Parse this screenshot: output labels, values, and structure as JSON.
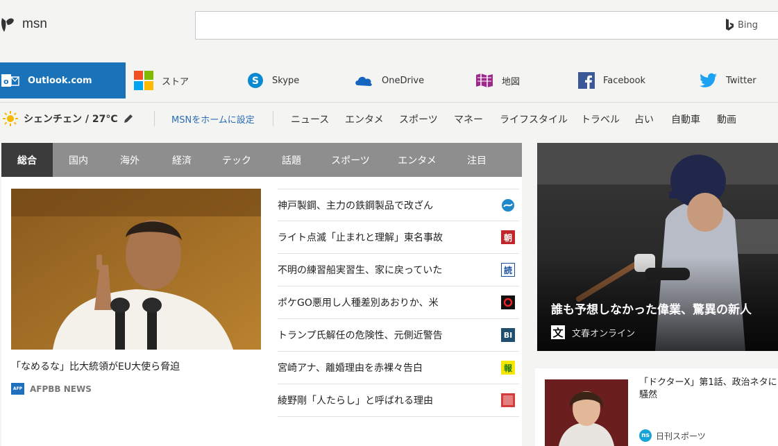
{
  "header": {
    "logo_text": "msn",
    "search_placeholder": "",
    "search_brand": "Bing"
  },
  "apps": [
    {
      "label": "Outlook.com",
      "icon": "outlook-icon"
    },
    {
      "label": "ストア",
      "icon": "store-icon"
    },
    {
      "label": "Skype",
      "icon": "skype-icon"
    },
    {
      "label": "OneDrive",
      "icon": "onedrive-icon"
    },
    {
      "label": "地図",
      "icon": "map-icon"
    },
    {
      "label": "Facebook",
      "icon": "facebook-icon"
    },
    {
      "label": "Twitter",
      "icon": "twitter-icon"
    }
  ],
  "subnav": {
    "weather": "シェンチェン / 27°C",
    "home_setting": "MSNをホームに設定",
    "links": [
      "ニュース",
      "エンタメ",
      "スポーツ",
      "マネー",
      "ライフスタイル",
      "トラベル",
      "占い",
      "自動車",
      "動画"
    ]
  },
  "tabs": [
    "総合",
    "国内",
    "海外",
    "経済",
    "テック",
    "話題",
    "スポーツ",
    "エンタメ",
    "注目"
  ],
  "hero": {
    "caption": "「なめるな」比大統領がEU大使ら脅迫",
    "source": "AFPBB NEWS",
    "source_badge": "AFP"
  },
  "headlines": [
    {
      "text": "神戸製鋼、主力の鉄鋼製品で改ざん",
      "badge": ""
    },
    {
      "text": "ライト点滅「止まれと理解」東名事故",
      "badge": "朝"
    },
    {
      "text": "不明の練習船実習生、家に戻っていた",
      "badge": "読"
    },
    {
      "text": "ポケGO悪用し人種差別あおりか、米",
      "badge": ""
    },
    {
      "text": "トランプ氏解任の危険性、元側近警告",
      "badge": "BI"
    },
    {
      "text": "宮崎アナ、離婚理由を赤裸々告白",
      "badge": "報"
    },
    {
      "text": "綾野剛「人たらし」と呼ばれる理由",
      "badge": ""
    }
  ],
  "photo_card": {
    "title": "誰も予想しなかった偉業、驚異の新人",
    "source": "文春オンライン",
    "source_badge": "文"
  },
  "small_card": {
    "title": "「ドクターX」第1話、政治ネタに騒然",
    "source": "日刊スポーツ",
    "source_badge": "ns"
  },
  "colors": {
    "outlook_blue": "#1a73b8",
    "tab_bar": "#8e8e8e",
    "tab_active": "#3b3b3b",
    "link_blue": "#2a6db5"
  }
}
